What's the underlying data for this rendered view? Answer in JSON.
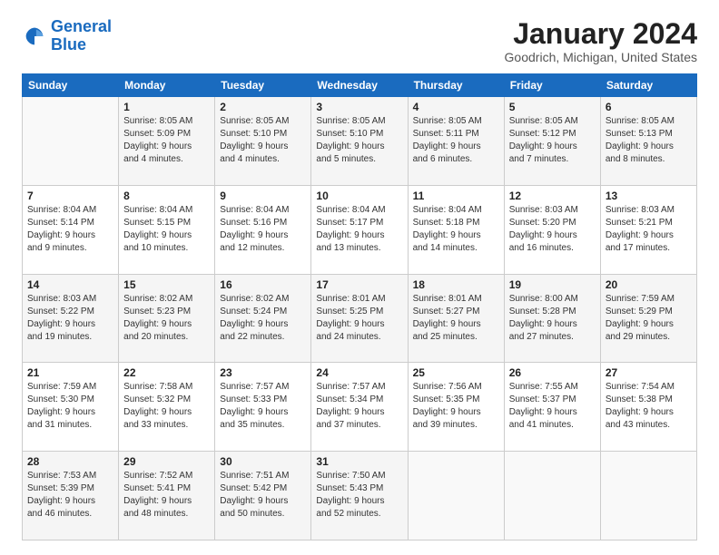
{
  "logo": {
    "line1": "General",
    "line2": "Blue"
  },
  "header": {
    "title": "January 2024",
    "subtitle": "Goodrich, Michigan, United States"
  },
  "days_of_week": [
    "Sunday",
    "Monday",
    "Tuesday",
    "Wednesday",
    "Thursday",
    "Friday",
    "Saturday"
  ],
  "weeks": [
    [
      {
        "day": "",
        "info": ""
      },
      {
        "day": "1",
        "info": "Sunrise: 8:05 AM\nSunset: 5:09 PM\nDaylight: 9 hours\nand 4 minutes."
      },
      {
        "day": "2",
        "info": "Sunrise: 8:05 AM\nSunset: 5:10 PM\nDaylight: 9 hours\nand 4 minutes."
      },
      {
        "day": "3",
        "info": "Sunrise: 8:05 AM\nSunset: 5:10 PM\nDaylight: 9 hours\nand 5 minutes."
      },
      {
        "day": "4",
        "info": "Sunrise: 8:05 AM\nSunset: 5:11 PM\nDaylight: 9 hours\nand 6 minutes."
      },
      {
        "day": "5",
        "info": "Sunrise: 8:05 AM\nSunset: 5:12 PM\nDaylight: 9 hours\nand 7 minutes."
      },
      {
        "day": "6",
        "info": "Sunrise: 8:05 AM\nSunset: 5:13 PM\nDaylight: 9 hours\nand 8 minutes."
      }
    ],
    [
      {
        "day": "7",
        "info": "Sunrise: 8:04 AM\nSunset: 5:14 PM\nDaylight: 9 hours\nand 9 minutes."
      },
      {
        "day": "8",
        "info": "Sunrise: 8:04 AM\nSunset: 5:15 PM\nDaylight: 9 hours\nand 10 minutes."
      },
      {
        "day": "9",
        "info": "Sunrise: 8:04 AM\nSunset: 5:16 PM\nDaylight: 9 hours\nand 12 minutes."
      },
      {
        "day": "10",
        "info": "Sunrise: 8:04 AM\nSunset: 5:17 PM\nDaylight: 9 hours\nand 13 minutes."
      },
      {
        "day": "11",
        "info": "Sunrise: 8:04 AM\nSunset: 5:18 PM\nDaylight: 9 hours\nand 14 minutes."
      },
      {
        "day": "12",
        "info": "Sunrise: 8:03 AM\nSunset: 5:20 PM\nDaylight: 9 hours\nand 16 minutes."
      },
      {
        "day": "13",
        "info": "Sunrise: 8:03 AM\nSunset: 5:21 PM\nDaylight: 9 hours\nand 17 minutes."
      }
    ],
    [
      {
        "day": "14",
        "info": "Sunrise: 8:03 AM\nSunset: 5:22 PM\nDaylight: 9 hours\nand 19 minutes."
      },
      {
        "day": "15",
        "info": "Sunrise: 8:02 AM\nSunset: 5:23 PM\nDaylight: 9 hours\nand 20 minutes."
      },
      {
        "day": "16",
        "info": "Sunrise: 8:02 AM\nSunset: 5:24 PM\nDaylight: 9 hours\nand 22 minutes."
      },
      {
        "day": "17",
        "info": "Sunrise: 8:01 AM\nSunset: 5:25 PM\nDaylight: 9 hours\nand 24 minutes."
      },
      {
        "day": "18",
        "info": "Sunrise: 8:01 AM\nSunset: 5:27 PM\nDaylight: 9 hours\nand 25 minutes."
      },
      {
        "day": "19",
        "info": "Sunrise: 8:00 AM\nSunset: 5:28 PM\nDaylight: 9 hours\nand 27 minutes."
      },
      {
        "day": "20",
        "info": "Sunrise: 7:59 AM\nSunset: 5:29 PM\nDaylight: 9 hours\nand 29 minutes."
      }
    ],
    [
      {
        "day": "21",
        "info": "Sunrise: 7:59 AM\nSunset: 5:30 PM\nDaylight: 9 hours\nand 31 minutes."
      },
      {
        "day": "22",
        "info": "Sunrise: 7:58 AM\nSunset: 5:32 PM\nDaylight: 9 hours\nand 33 minutes."
      },
      {
        "day": "23",
        "info": "Sunrise: 7:57 AM\nSunset: 5:33 PM\nDaylight: 9 hours\nand 35 minutes."
      },
      {
        "day": "24",
        "info": "Sunrise: 7:57 AM\nSunset: 5:34 PM\nDaylight: 9 hours\nand 37 minutes."
      },
      {
        "day": "25",
        "info": "Sunrise: 7:56 AM\nSunset: 5:35 PM\nDaylight: 9 hours\nand 39 minutes."
      },
      {
        "day": "26",
        "info": "Sunrise: 7:55 AM\nSunset: 5:37 PM\nDaylight: 9 hours\nand 41 minutes."
      },
      {
        "day": "27",
        "info": "Sunrise: 7:54 AM\nSunset: 5:38 PM\nDaylight: 9 hours\nand 43 minutes."
      }
    ],
    [
      {
        "day": "28",
        "info": "Sunrise: 7:53 AM\nSunset: 5:39 PM\nDaylight: 9 hours\nand 46 minutes."
      },
      {
        "day": "29",
        "info": "Sunrise: 7:52 AM\nSunset: 5:41 PM\nDaylight: 9 hours\nand 48 minutes."
      },
      {
        "day": "30",
        "info": "Sunrise: 7:51 AM\nSunset: 5:42 PM\nDaylight: 9 hours\nand 50 minutes."
      },
      {
        "day": "31",
        "info": "Sunrise: 7:50 AM\nSunset: 5:43 PM\nDaylight: 9 hours\nand 52 minutes."
      },
      {
        "day": "",
        "info": ""
      },
      {
        "day": "",
        "info": ""
      },
      {
        "day": "",
        "info": ""
      }
    ]
  ]
}
